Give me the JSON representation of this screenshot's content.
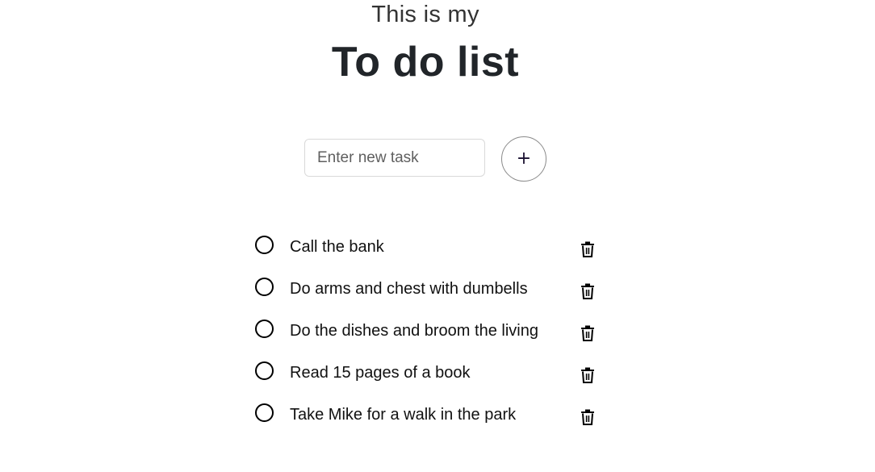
{
  "header": {
    "subtitle": "This is my",
    "title": "To do list"
  },
  "new_task": {
    "placeholder": "Enter new task",
    "value": "",
    "add_label": "+"
  },
  "tasks": [
    {
      "text": "Call the bank",
      "done": false
    },
    {
      "text": "Do arms and chest with dumbells",
      "done": false
    },
    {
      "text": "Do the dishes and broom the living",
      "done": false
    },
    {
      "text": "Read 15 pages of a book",
      "done": false
    },
    {
      "text": "Take Mike for a walk in the park",
      "done": false
    }
  ],
  "icons": {
    "checkbox": "circle-checkbox-icon",
    "delete": "trash-icon"
  }
}
